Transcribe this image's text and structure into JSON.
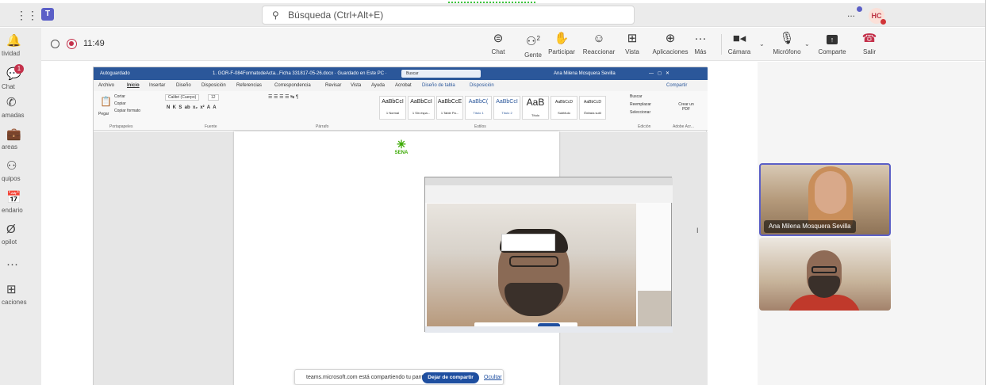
{
  "topbar": {
    "search_placeholder": "Búsqueda (Ctrl+Alt+E)",
    "avatar_initials": "HC",
    "more": "..."
  },
  "rail": [
    {
      "icon": "bell-icon",
      "glyph": "🔔",
      "label": "tividad"
    },
    {
      "icon": "chat-icon",
      "glyph": "💬",
      "label": "Chat",
      "badge": "1"
    },
    {
      "icon": "phone-icon",
      "glyph": "✆",
      "label": "amadas"
    },
    {
      "icon": "briefcase-icon",
      "glyph": "💼",
      "label": "areas"
    },
    {
      "icon": "teams-icon",
      "glyph": "⚇",
      "label": "quipos"
    },
    {
      "icon": "calendar-icon",
      "glyph": "📅",
      "label": "endario"
    },
    {
      "icon": "copilot-icon",
      "glyph": "Ø",
      "label": "opilot"
    },
    {
      "icon": "more-icon",
      "glyph": "···",
      "label": ""
    },
    {
      "icon": "add-apps-icon",
      "glyph": "⊞",
      "label": "caciones"
    }
  ],
  "meeting": {
    "timer": "11:49",
    "people_count": "2",
    "buttons": {
      "chat": "Chat",
      "people": "Gente",
      "raise": "Participar",
      "react": "Reaccionar",
      "view": "Vista",
      "apps": "Aplicaciones",
      "more": "Más",
      "camera": "Cámara",
      "mic": "Micrófono",
      "share": "Comparte",
      "leave": "Salir"
    }
  },
  "word": {
    "autosave": "Autoguardado",
    "filename": "1. GOR-F-084FormatodeActa...Ficha 331817-05-26.docx · Guardado en Este PC ·",
    "search": "Buscar",
    "user": "Ana Milena Mosquera Sevilla",
    "menu": [
      "Archivo",
      "Inicio",
      "Insertar",
      "Diseño",
      "Disposición",
      "Referencias",
      "Correspondencia",
      "Revisar",
      "Vista",
      "Ayuda",
      "Acrobat",
      "Diseño de tabla",
      "Disposición"
    ],
    "share_label": "Compartir",
    "ribbon": {
      "paste": "Pegar",
      "cut": "Cortar",
      "copy": "Copiar",
      "format_painter": "Copiar formato",
      "font": "Calibri (Cuerpo)",
      "size": "12",
      "group_clipboard": "Portapapeles",
      "group_font": "Fuente",
      "group_paragraph": "Párrafo",
      "group_styles": "Estilos",
      "group_editing": "Edición",
      "group_adobe": "Adobe Acr...",
      "find": "Buscar",
      "replace": "Reemplazar",
      "select": "Seleccionar",
      "create_pdf": "Crear un PDF"
    },
    "styles": [
      {
        "sample": "AaBbCcI",
        "name": "1 Normal"
      },
      {
        "sample": "AaBbCcI",
        "name": "1 Sin espa..."
      },
      {
        "sample": "AaBbCcE",
        "name": "1 Table Pa..."
      },
      {
        "sample": "AaBbC(",
        "name": "Título 1"
      },
      {
        "sample": "AaBbCcI",
        "name": "Título 2"
      },
      {
        "sample": "AaB",
        "name": "Título"
      },
      {
        "sample": "AaBbCcD",
        "name": "Subtítulo"
      },
      {
        "sample": "AaBbCcD",
        "name": "Énfasis sutil"
      }
    ],
    "logo_text": "SENA"
  },
  "share_toast": {
    "text": "teams.microsoft.com está compartiendo tu pantalla.",
    "stop": "Dejar de compartir",
    "hide": "Ocultar"
  },
  "participants": [
    {
      "name": "Ana Milena Mosquera Sevilla"
    },
    {
      "name": ""
    }
  ]
}
